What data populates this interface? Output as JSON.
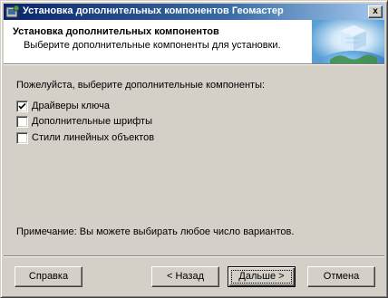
{
  "window": {
    "title": "Установка дополнительных компонентов Геомастер",
    "close_glyph": "x"
  },
  "header": {
    "title": "Установка дополнительных компонентов",
    "subtitle": "Выберите дополнительные компоненты для  установки."
  },
  "body": {
    "prompt": "Пожелуйста, выберите дополнительные компоненты:",
    "options": [
      {
        "label": "Драйверы ключа",
        "checked": true
      },
      {
        "label": "Дополнительные шрифты",
        "checked": false
      },
      {
        "label": "Стили линейных объектов",
        "checked": false
      }
    ],
    "note": "Примечание: Вы можете выбирать любое число вариантов."
  },
  "buttons": {
    "help": "Справка",
    "back": "< Назад",
    "next": "Дальше >",
    "cancel": "Отмена"
  },
  "colors": {
    "title_bar_start": "#0a246a",
    "title_bar_end": "#a6caf0",
    "face": "#d4d0c8"
  },
  "icons": {
    "app": "installer-icon",
    "header": "globe-cube-icon",
    "close": "close-icon",
    "check": "checkmark-icon"
  }
}
